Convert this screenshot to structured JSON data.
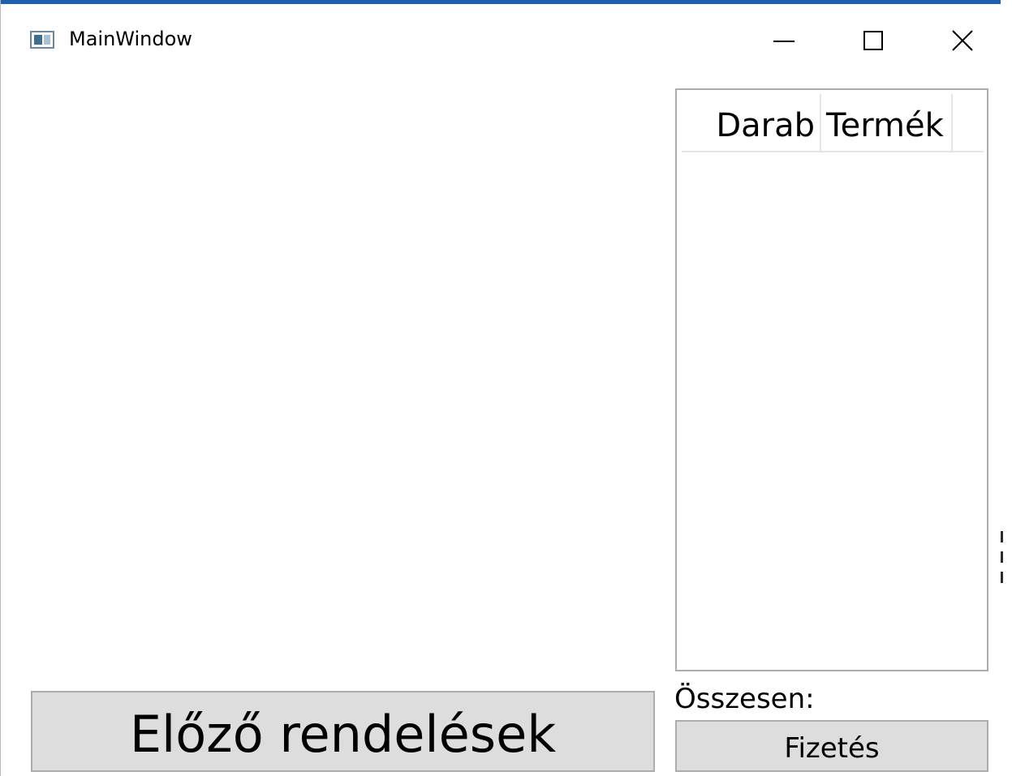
{
  "window": {
    "title": "MainWindow",
    "controls": {
      "minimize_icon": "minimize-icon",
      "maximize_icon": "maximize-icon",
      "close_icon": "close-icon"
    }
  },
  "order_list": {
    "columns": [
      "Darab",
      "Termék"
    ],
    "rows": []
  },
  "footer": {
    "previous_orders_label": "Előző rendelések",
    "total_label": "Összesen:",
    "pay_label": "Fizetés"
  },
  "colors": {
    "title_accent": "#1e5fae",
    "button_bg": "#dddddd",
    "border": "#adadad"
  }
}
